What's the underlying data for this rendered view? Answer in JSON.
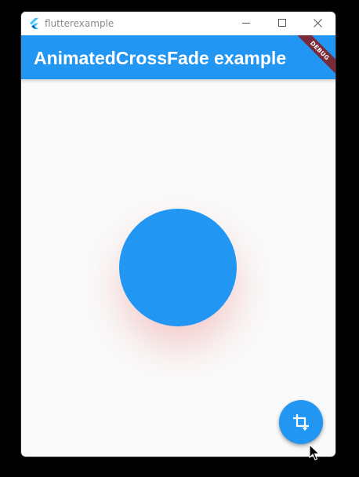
{
  "window": {
    "title": "flutterexample"
  },
  "appbar": {
    "title": "AnimatedCrossFade example",
    "color": "#2196f3",
    "debug_banner": "DEBUG",
    "debug_banner_color": "#7a2b3a"
  },
  "content": {
    "circle_color": "#2196f3",
    "shadow_color": "#e65a5a"
  },
  "fab": {
    "icon": "crop-rotate-icon",
    "color": "#2196f3"
  },
  "icons": {
    "app": "flutter-logo-icon",
    "minimize": "minimize-icon",
    "maximize": "maximize-icon",
    "close": "close-icon",
    "cursor": "mouse-cursor-icon"
  }
}
